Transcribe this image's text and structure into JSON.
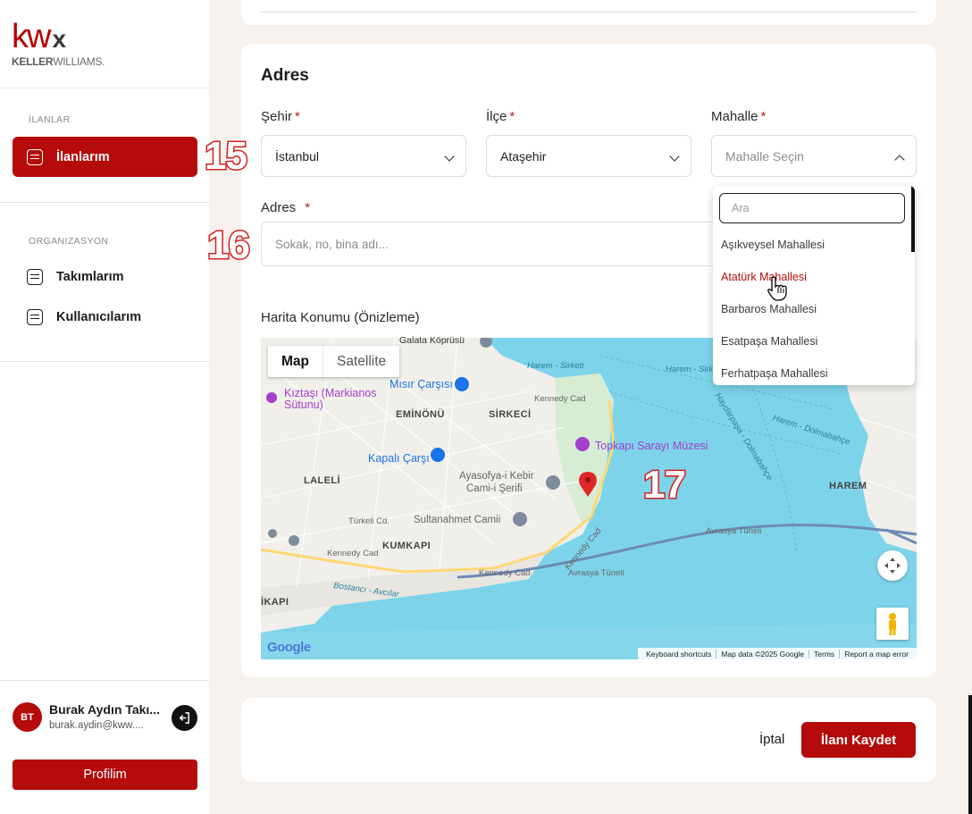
{
  "brand": {
    "logo_kw": "kw",
    "logo_x": "x",
    "logo_sub_bold": "KELLER",
    "logo_sub": "WILLIAMS.",
    "accent": "#b50b0b"
  },
  "sidebar": {
    "section_listings": "İLANLAR",
    "item_listings": "İlanlarım",
    "section_org": "ORGANIZASYON",
    "item_teams": "Takımlarım",
    "item_users": "Kullanıcılarım"
  },
  "user": {
    "initials": "BT",
    "name": "Burak Aydın Takı...",
    "email": "burak.aydin@kww....",
    "profile_button": "Profilim"
  },
  "form": {
    "section_title": "Adres",
    "city_label": "Şehir",
    "city_value": "İstanbul",
    "district_label": "İlçe",
    "district_value": "Ataşehir",
    "neighborhood_label": "Mahalle",
    "neighborhood_placeholder": "Mahalle Seçin",
    "address_label": "Adres",
    "address_placeholder": "Sokak, no, bina adı...",
    "required_mark": "*"
  },
  "annotations": {
    "step15": "15",
    "step16": "16",
    "step17": "17"
  },
  "dropdown": {
    "search_placeholder": "Ara",
    "options": [
      "Aşıkveysel Mahallesi",
      "Atatürk Mahallesi",
      "Barbaros Mahallesi",
      "Esatpaşa Mahallesi",
      "Ferhatpaşa Mahallesi"
    ],
    "hovered_index": 1
  },
  "map": {
    "label": "Harita Konumu (Önizleme)",
    "tab_map": "Map",
    "tab_satellite": "Satellite",
    "places": {
      "galata": "Galata Köprüsü",
      "kiztasi": "Kıztaşı (Markianos",
      "kiztasi2": "Sütunu)",
      "misir": "Mısır Çarşısı",
      "eminonu": "EMİNÖNÜ",
      "sirkeci": "SİRKECİ",
      "kapali": "Kapalı Çarşı",
      "topkapi": "Topkapı Sarayı Müzesi",
      "ayasofya": "Ayasofya-i Kebir",
      "ayasofya2": "Cami-i Şerifi",
      "laleli": "LALELİ",
      "sultanahmet": "Sultanahmet Camii",
      "kumkapi": "KUMKAPI",
      "turkeli": "Türkeli Cd.",
      "kennedy1": "Kennedy Cad",
      "kennedy2": "Kennedy Cad",
      "kennedy3": "Kennedy Cad",
      "kennedy4": "Kennedy Cad",
      "avrasya1": "Avrasya Tüneli",
      "avrasya2": "Avrasya Tüneli",
      "harem": "HAREM",
      "harem_sirketi": "Harem - Sirketi",
      "harem_sirketi2": "Harem - Sirketi",
      "haydarpasa": "Haydarpaşa - Dolmabahçe",
      "harem_dolmabahce": "Harem - Dolmabahçe",
      "bostanci": "Bostancı - Avcılar",
      "aksaray": "İKAPI"
    },
    "attribution": {
      "shortcuts": "Keyboard shortcuts",
      "data": "Map data ©2025 Google",
      "terms": "Terms",
      "report": "Report a map error"
    },
    "google": "Google"
  },
  "footer": {
    "cancel": "İptal",
    "save": "İlanı Kaydet"
  }
}
